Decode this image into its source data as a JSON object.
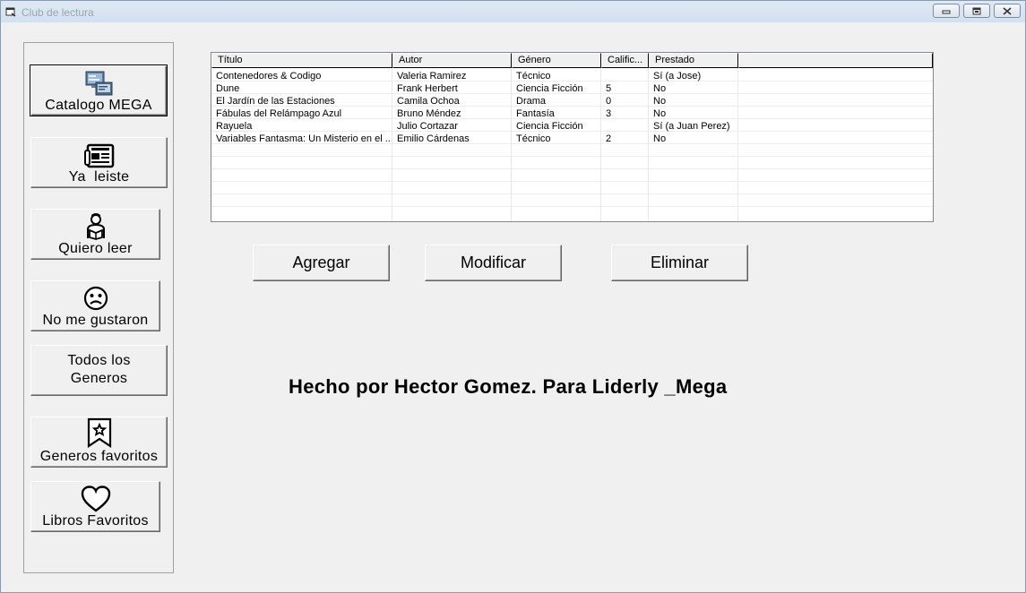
{
  "window": {
    "title": "Club de lectura"
  },
  "sidebar": {
    "items": [
      {
        "label": "Catalogo MEGA",
        "icon": "catalog-computer-icon",
        "active": true
      },
      {
        "label": "Ya  leiste",
        "icon": "newspaper-icon"
      },
      {
        "label": "Quiero leer",
        "icon": "reader-person-icon"
      },
      {
        "label": "No me gustaron",
        "icon": "sad-face-icon"
      },
      {
        "label_line1": "Todos los",
        "label_line2": "Generos"
      },
      {
        "label": "Generos favoritos",
        "icon": "bookmark-star-icon"
      },
      {
        "label": "Libros Favoritos",
        "icon": "heart-icon"
      }
    ]
  },
  "table": {
    "columns": [
      "Título",
      "Autor",
      "Género",
      "Calific...",
      "Prestado"
    ],
    "rows": [
      [
        "Contenedores & Codigo",
        "Valeria Ramirez",
        "Técnico",
        "",
        "Sí (a Jose)"
      ],
      [
        "Dune",
        "Frank Herbert",
        "Ciencia Ficción",
        "5",
        "No"
      ],
      [
        "El Jardín de las Estaciones",
        "Camila Ochoa",
        "Drama",
        "0",
        "No"
      ],
      [
        "Fábulas del Relámpago Azul",
        "Bruno Méndez",
        "Fantasía",
        "3",
        "No"
      ],
      [
        "Rayuela",
        "Julio Cortazar",
        "Ciencia Ficción",
        "",
        "Sí (a Juan Perez)"
      ],
      [
        "Variables Fantasma: Un Misterio en el ...",
        "Emilio Cárdenas",
        "Técnico",
        "2",
        "No"
      ]
    ]
  },
  "actions": {
    "add": "Agregar",
    "modify": "Modificar",
    "delete": "Eliminar"
  },
  "credit": "Hecho por Hector Gomez. Para Liderly _Mega"
}
